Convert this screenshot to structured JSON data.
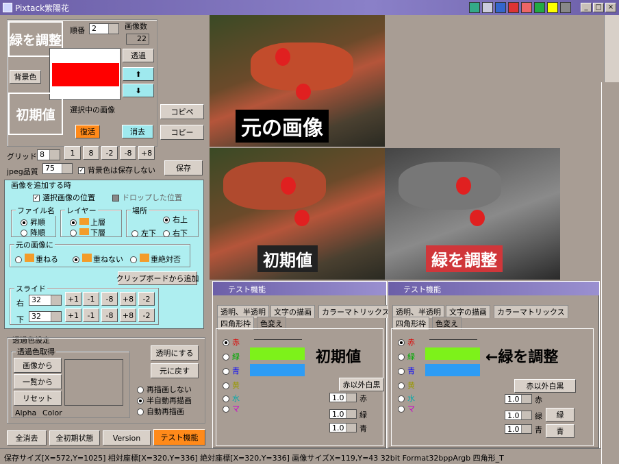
{
  "app": {
    "title": "Pixtack紫陽花"
  },
  "left": {
    "label_green": "緑を調整",
    "label_order": "順番",
    "order": "2",
    "label_count": "画像数",
    "count": "22",
    "btn_transparent": "透過",
    "btn_bg": "背景色",
    "label_initial": "初期値",
    "label_selected": "選択中の画像",
    "btn_restore": "復活",
    "btn_delete": "消去",
    "btn_copy_paste": "コピペ",
    "btn_copy": "コピー",
    "label_grid": "グリッド",
    "grid": "8",
    "grid_btns": [
      "1",
      "8",
      "-2",
      "-8",
      "+8"
    ],
    "label_jpeg": "jpeg品質",
    "jpeg": "75",
    "chk_bg": "背景色は保存しない",
    "btn_save": "保存",
    "add_title": "画像を追加する時",
    "chk_selpos": "選択画像の位置",
    "chk_droppos": "ドロップした位置",
    "fn_title": "ファイル名",
    "fn_asc": "昇順",
    "fn_desc": "降順",
    "layer_title": "レイヤー",
    "layer_up": "上層",
    "layer_down": "下層",
    "place_title": "場所",
    "place_ur": "右上",
    "place_ll": "左下",
    "place_lr": "右下",
    "orig_title": "元の画像に",
    "orig_overlap": "重ねる",
    "orig_no": "重ねない",
    "orig_abs": "重絶対否",
    "btn_clip": "クリップボードから追加",
    "slide_title": "スライド",
    "slide_right": "右",
    "slide_right_v": "32",
    "slide_down": "下",
    "slide_down_v": "32",
    "slide_btns": [
      "+1",
      "-1",
      "-8",
      "+8",
      "-2"
    ],
    "trans_title": "透過色設定",
    "trans_get": "透過色取得",
    "btn_from_img": "画像から",
    "btn_from_list": "一覧から",
    "btn_reset": "リセット",
    "alpha": "Alpha",
    "color": "Color",
    "btn_make_trans": "透明にする",
    "btn_revert": "元に戻す",
    "redraw_none": "再描画しない",
    "redraw_semi": "半自動再描画",
    "redraw_auto": "自動再描画",
    "tabs": [
      "全消去",
      "全初期状態",
      "Version",
      "テスト機能"
    ]
  },
  "canvas": {
    "cap_orig": "元の画像",
    "cap_init": "初期値",
    "cap_green": "緑を調整"
  },
  "test": {
    "title": "テスト機能",
    "tabs_row1": [
      "透明、半透明",
      "文字の描画",
      "カラーマトリックス"
    ],
    "tabs_row2": [
      "四角形枠",
      "色変え"
    ],
    "ch": [
      "赤",
      "緑",
      "青",
      "黄",
      "水",
      "マ"
    ],
    "btn_exred": "赤以外白黒",
    "spin": "1.0",
    "lbl_r": "赤",
    "lbl_g": "緑",
    "lbl_b": "青",
    "ann_left": "初期値",
    "ann_right": "←緑を調整"
  },
  "status": "保存サイズ[X=572,Y=1025] 相対座標[X=320,Y=336] 絶対座標[X=320,Y=336] 画像サイズX=119,Y=43 32bit Format32bppArgb 四角形_T",
  "colors": {
    "accent_orange": "#ff8a1a",
    "panel_cyan": "#aeeef0",
    "red": "#ff0000"
  }
}
